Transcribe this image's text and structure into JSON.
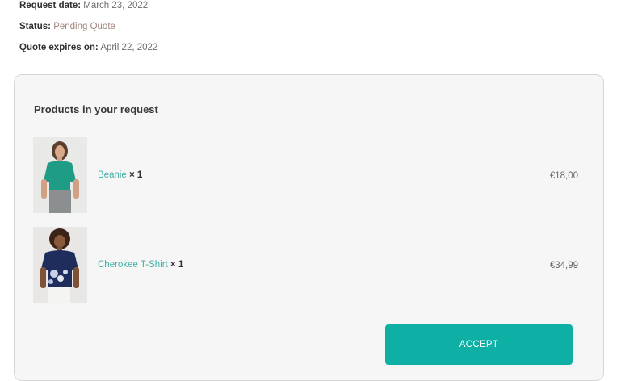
{
  "request_info": {
    "request_date": {
      "label": "Request date:",
      "value": "March 23, 2022"
    },
    "status": {
      "label": "Status:",
      "value": "Pending Quote"
    },
    "expires": {
      "label": "Quote expires on:",
      "value": "April 22, 2022"
    }
  },
  "products_card": {
    "title": "Products in your request",
    "items": [
      {
        "name": "Beanie",
        "qty": "× 1",
        "price": "€18,00",
        "image": "woman-green-top-photo"
      },
      {
        "name": "Cherokee T-Shirt",
        "qty": "× 1",
        "price": "€34,99",
        "image": "woman-navy-floral-tshirt-photo"
      }
    ],
    "accept_label": "ACCEPT"
  },
  "colors": {
    "accent": "#0eafa5",
    "link": "#3fb0a7",
    "status": "#a0857a",
    "card_bg": "#f6f6f6"
  }
}
